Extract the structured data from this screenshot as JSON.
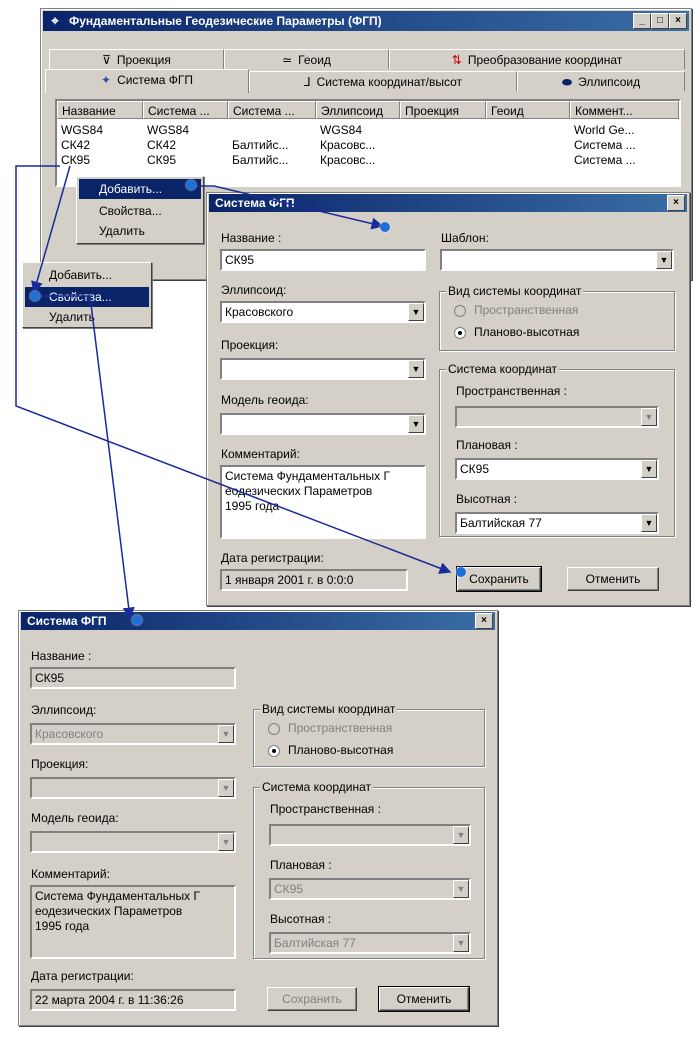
{
  "main_window": {
    "title": "Фундаментальные Геодезические Параметры (ФГП)",
    "tabs_row1": [
      "Проекция",
      "Геоид",
      "Преобразование координат"
    ],
    "tabs_row2": [
      "Система ФГП",
      "Система координат/высот",
      "Эллипсоид"
    ],
    "columns": [
      "Название",
      "Система ...",
      "Система ...",
      "Эллипсоид",
      "Проекция",
      "Геоид",
      "Коммент..."
    ],
    "rows": [
      [
        "WGS84",
        "WGS84",
        "",
        "WGS84",
        "",
        "",
        "World Ge..."
      ],
      [
        "СК42",
        "СК42",
        "Балтийс...",
        "Красовс...",
        "",
        "",
        "Система ..."
      ],
      [
        "СК95",
        "СК95",
        "Балтийс...",
        "Красовс...",
        "",
        "",
        "Система ..."
      ]
    ]
  },
  "context_menu_1": {
    "items": [
      "Добавить...",
      "Свойства...",
      "Удалить"
    ],
    "selected": 0
  },
  "context_menu_2": {
    "items": [
      "Добавить...",
      "Свойства...",
      "Удалить"
    ],
    "selected": 1
  },
  "dialog_edit": {
    "title": "Система ФГП",
    "name_label": "Название :",
    "name_value": "СК95",
    "template_label": "Шаблон:",
    "template_value": "",
    "ellipsoid_label": "Эллипсоид:",
    "ellipsoid_value": "Красовского",
    "projection_label": "Проекция:",
    "projection_value": "",
    "geoid_label": "Модель геоида:",
    "geoid_value": "",
    "comment_label": "Комментарий:",
    "comment_value": "Система Фундаментальных Г\nеодезических Параметров\n1995 года",
    "date_label": "Дата регистрации:",
    "date_value": "1 января 2001 г.  в 0:0:0",
    "kind_group": "Вид системы координат",
    "kind_spatial": "Пространственная",
    "kind_planar": "Планово-высотная",
    "coord_group": "Система координат",
    "spatial_label": "Пространственная :",
    "spatial_value": "",
    "planar_label": "Плановая :",
    "planar_value": "СК95",
    "height_label": "Высотная :",
    "height_value": "Балтийская 77",
    "save": "Сохранить",
    "cancel": "Отменить"
  },
  "dialog_view": {
    "title": "Система ФГП",
    "name_label": "Название :",
    "name_value": "СК95",
    "ellipsoid_label": "Эллипсоид:",
    "ellipsoid_value": "Красовского",
    "projection_label": "Проекция:",
    "projection_value": "",
    "geoid_label": "Модель геоида:",
    "geoid_value": "",
    "comment_label": "Комментарий:",
    "comment_value": "Система Фундаментальных Г\nеодезических Параметров\n1995 года",
    "date_label": "Дата регистрации:",
    "date_value": "22 марта 2004 г.  в 11:36:26",
    "kind_group": "Вид системы координат",
    "kind_spatial": "Пространственная",
    "kind_planar": "Планово-высотная",
    "coord_group": "Система координат",
    "spatial_label": "Пространственная :",
    "spatial_value": "",
    "planar_label": "Плановая :",
    "planar_value": "СК95",
    "height_label": "Высотная :",
    "height_value": "Балтийская 77",
    "save": "Сохранить",
    "cancel": "Отменить"
  },
  "colors": {
    "titlebar": "#0a246a",
    "face": "#d4d0c8",
    "arrow": "#1a2a9a",
    "dot": "#1e6fd8"
  }
}
